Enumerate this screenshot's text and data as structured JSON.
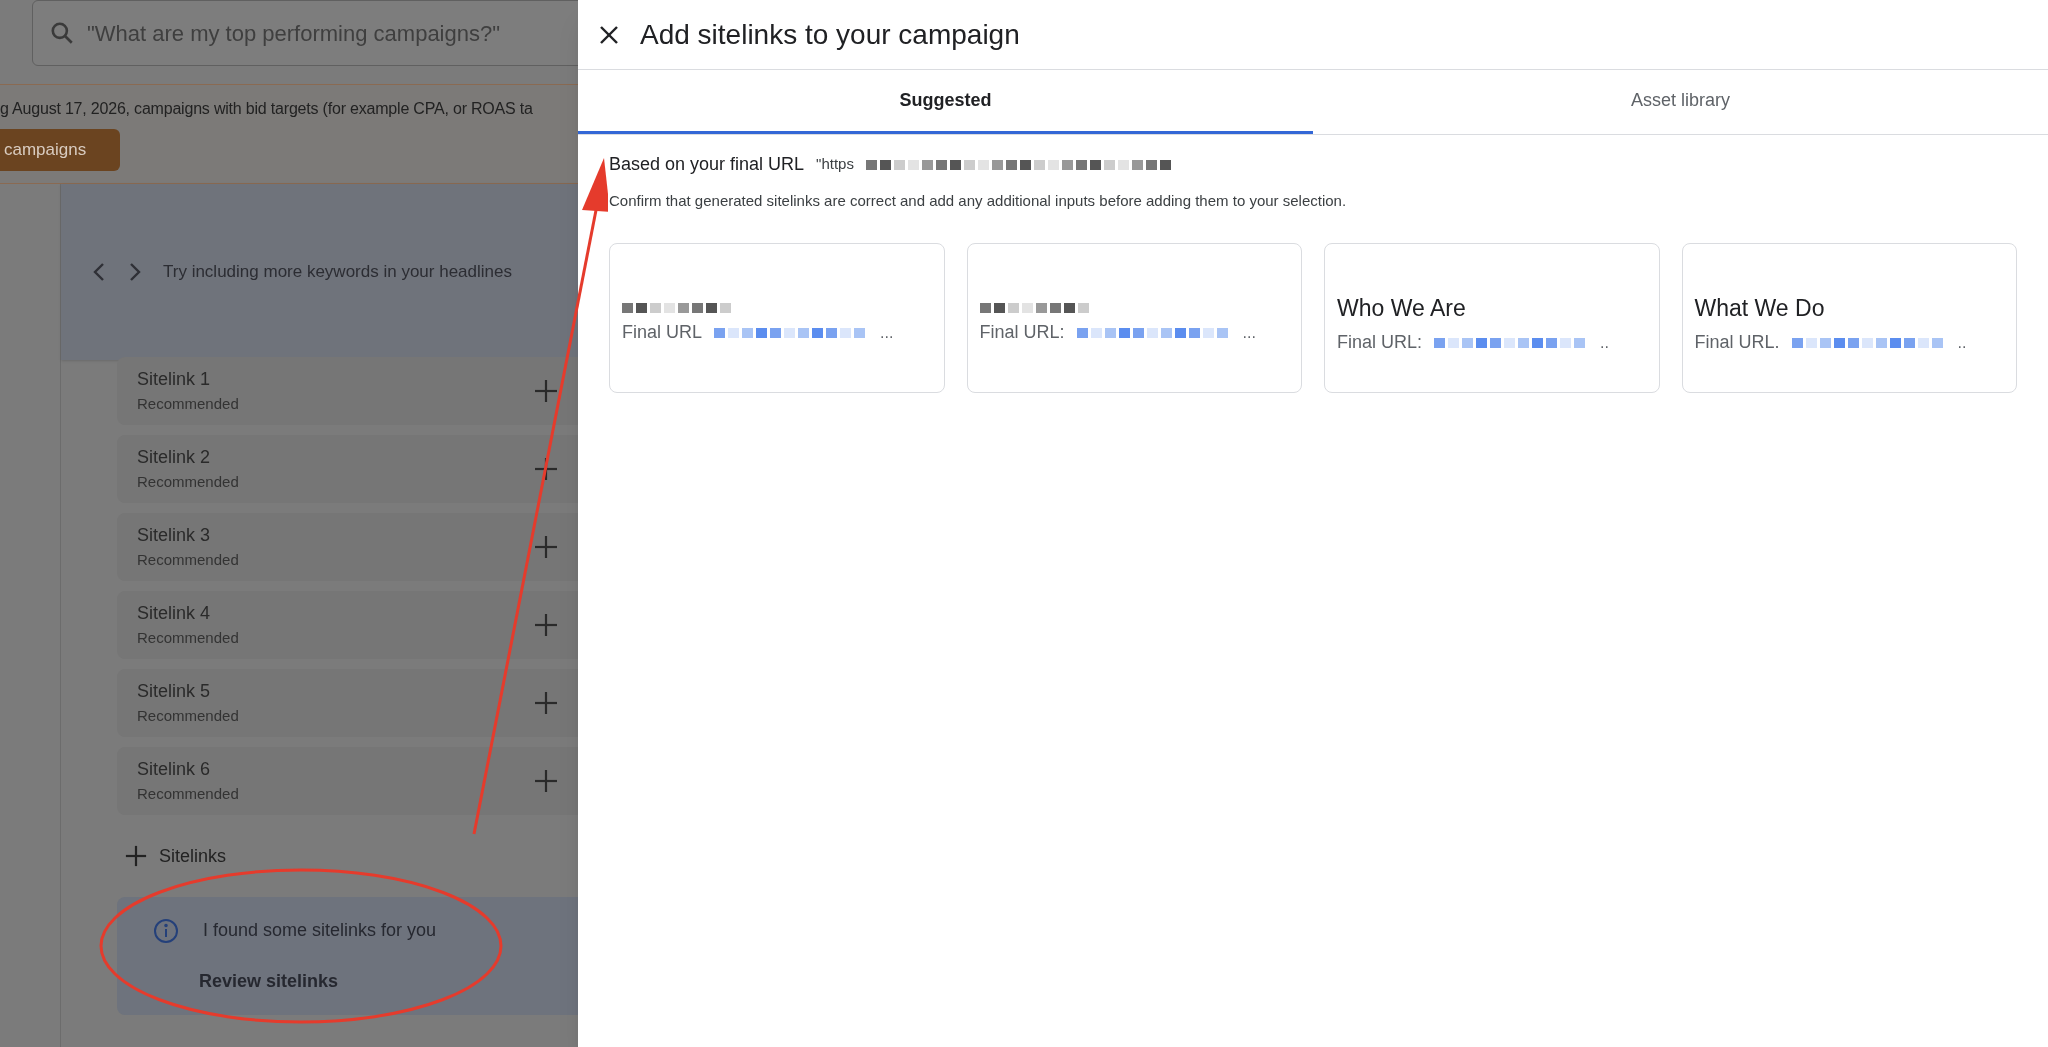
{
  "background": {
    "search": {
      "placeholder": "\"What are my top performing campaigns?\""
    },
    "notice": {
      "text": "g August 17, 2026, campaigns with bid targets (for example CPA, or ROAS ta",
      "button": "campaigns"
    },
    "suggestion": {
      "text": "Try including more keywords in your headlines"
    },
    "sitelinks": [
      {
        "title": "Sitelink 1",
        "subtitle": "Recommended"
      },
      {
        "title": "Sitelink 2",
        "subtitle": "Recommended"
      },
      {
        "title": "Sitelink 3",
        "subtitle": "Recommended"
      },
      {
        "title": "Sitelink 4",
        "subtitle": "Recommended"
      },
      {
        "title": "Sitelink 5",
        "subtitle": "Recommended"
      },
      {
        "title": "Sitelink 6",
        "subtitle": "Recommended"
      }
    ],
    "add_button": "Sitelinks",
    "info": {
      "text": "I found some sitelinks for you",
      "action": "Review sitelinks"
    }
  },
  "panel": {
    "title": "Add sitelinks to your campaign",
    "tabs": [
      {
        "label": "Suggested",
        "selected": true
      },
      {
        "label": "Asset library",
        "selected": false
      }
    ],
    "source_label": "Based on your final URL",
    "source_prefix": "\"https",
    "instructions": "Confirm that generated sitelinks are correct and add any additional inputs before adding them to your selection.",
    "cards": [
      {
        "title_redacted": true,
        "url_label": "Final URL",
        "url_end": "..."
      },
      {
        "title_redacted": true,
        "url_label": "Final URL:",
        "url_end": "..."
      },
      {
        "title": "Who We Are",
        "url_label": "Final URL:",
        "url_end": ".."
      },
      {
        "title": "What We Do",
        "url_label": "Final URL.",
        "url_end": ".."
      }
    ]
  }
}
